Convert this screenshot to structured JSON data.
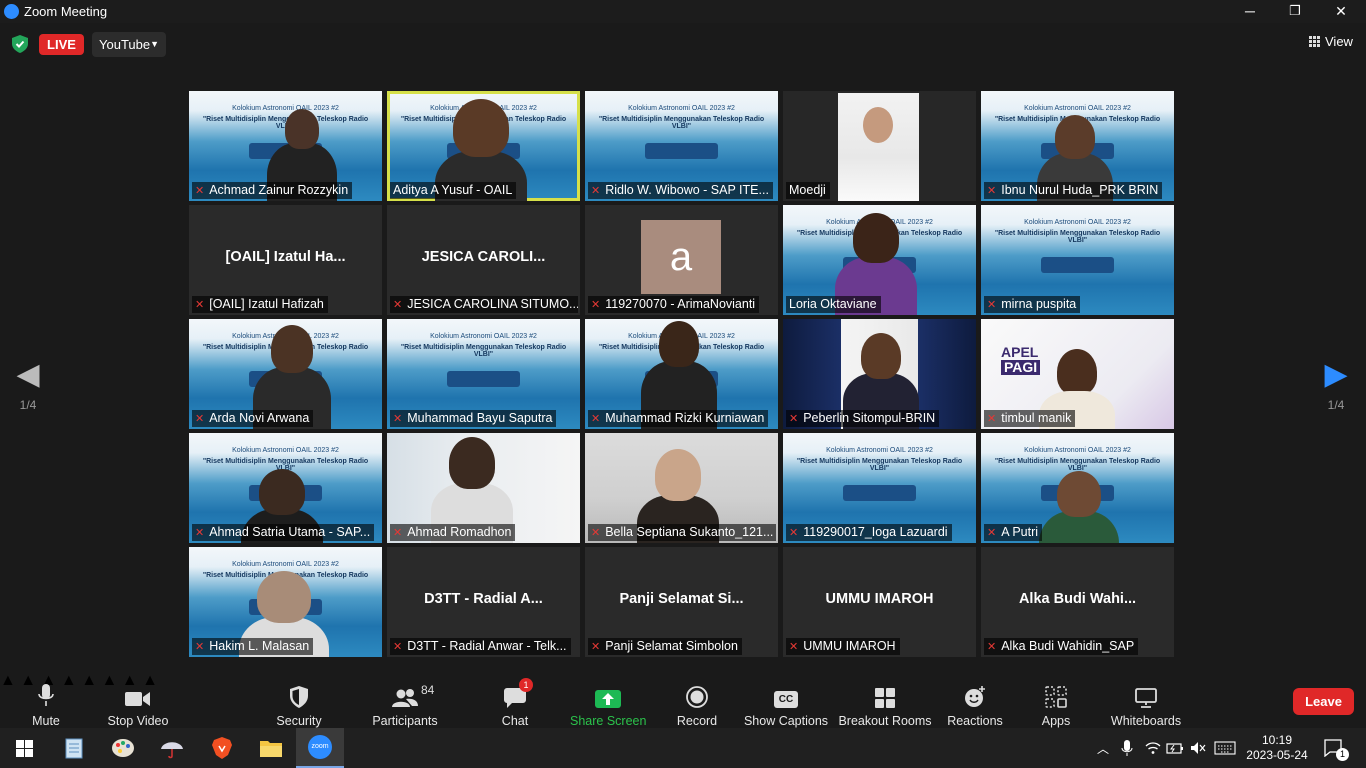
{
  "window": {
    "title": "Zoom Meeting",
    "minimize": "─",
    "restore": "❐",
    "close": "✕"
  },
  "topbar": {
    "live_label": "LIVE",
    "stream_target": "YouTube",
    "view_label": "View"
  },
  "pager": {
    "left_arrow": "◀",
    "right_arrow": "▶",
    "page": "1/4"
  },
  "tiles": [
    {
      "name": "Achmad Zainur Rozzykin",
      "type": "video",
      "muted": true
    },
    {
      "name": "Aditya A Yusuf - OAIL",
      "type": "video",
      "muted": false,
      "active": true
    },
    {
      "name": "Ridlo W. Wibowo - SAP ITE...",
      "type": "video",
      "muted": true
    },
    {
      "name": "Moedji",
      "type": "portrait",
      "muted": false
    },
    {
      "name": "Ibnu Nurul Huda_PRK BRIN",
      "type": "video",
      "muted": true
    },
    {
      "name": "[OAIL] Izatul Hafizah",
      "type": "name",
      "display": "[OAIL] Izatul Ha...",
      "muted": true
    },
    {
      "name": "JESICA CAROLINA SITUMO...",
      "type": "name",
      "display": "JESICA CAROLI...",
      "muted": true
    },
    {
      "name": "119270070 - ArimaNovianti",
      "type": "avatar",
      "avatar_letter": "a",
      "muted": true
    },
    {
      "name": "Loria Oktaviane",
      "type": "video",
      "muted": false
    },
    {
      "name": "mirna puspita",
      "type": "video",
      "muted": true
    },
    {
      "name": "Arda Novi Arwana",
      "type": "video",
      "muted": true
    },
    {
      "name": "Muhammad Bayu Saputra",
      "type": "video",
      "muted": true
    },
    {
      "name": "Muhammad Rizki Kurniawan",
      "type": "video",
      "muted": true
    },
    {
      "name": "Peberlin Sitompul-BRIN",
      "type": "cam",
      "muted": true
    },
    {
      "name": "timbul manik",
      "type": "apel",
      "muted": true
    },
    {
      "name": "Ahmad Satria Utama - SAP...",
      "type": "video",
      "muted": true
    },
    {
      "name": "Ahmad Romadhon",
      "type": "cam",
      "muted": true
    },
    {
      "name": "Bella Septiana Sukanto_121...",
      "type": "cam",
      "muted": true
    },
    {
      "name": "119290017_Ioga Lazuardi",
      "type": "video",
      "muted": true
    },
    {
      "name": "A Putri",
      "type": "video",
      "muted": true
    },
    {
      "name": "Hakim L. Malasan",
      "type": "video",
      "muted": true
    },
    {
      "name": "D3TT - Radial Anwar - Telk...",
      "type": "name",
      "display": "D3TT - Radial A...",
      "muted": true
    },
    {
      "name": "Panji Selamat Simbolon",
      "type": "name",
      "display": "Panji Selamat Si...",
      "muted": true
    },
    {
      "name": "UMMU IMAROH",
      "type": "name",
      "display": "UMMU IMAROH",
      "muted": true
    },
    {
      "name": "Alka Budi Wahidin_SAP",
      "type": "name",
      "display": "Alka Budi Wahi...",
      "muted": true
    }
  ],
  "banner": {
    "line1": "Kolokium Astronomi OAIL 2023 #2",
    "line2": "\"Riset Multidisiplin Menggunakan Teleskop Radio VLBI\""
  },
  "apel": {
    "word1": "APEL",
    "word2": "PAGI"
  },
  "toolbar": {
    "mute": "Mute",
    "stop_video": "Stop Video",
    "security": "Security",
    "participants": "Participants",
    "participants_count": "84",
    "chat": "Chat",
    "chat_badge": "1",
    "share": "Share Screen",
    "record": "Record",
    "captions": "Show Captions",
    "captions_icon": "CC",
    "breakout": "Breakout Rooms",
    "reactions": "Reactions",
    "apps": "Apps",
    "whiteboards": "Whiteboards",
    "leave": "Leave"
  },
  "taskbar": {
    "zoom_label": "zoom",
    "time": "10:19",
    "date": "2023-05-24",
    "notif_count": "1"
  }
}
